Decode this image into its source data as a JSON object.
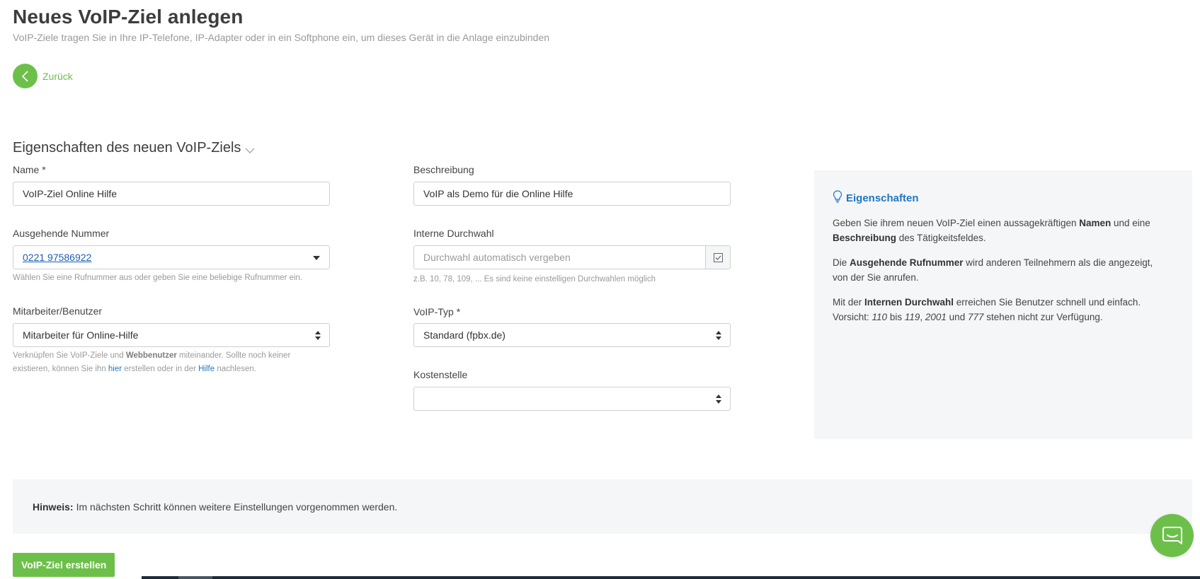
{
  "header": {
    "title": "Neues VoIP-Ziel anlegen",
    "subtitle": "VoIP-Ziele tragen Sie in Ihre IP-Telefone, IP-Adapter oder in ein Softphone ein, um dieses Gerät in die Anlage einzubinden"
  },
  "back": {
    "label": "Zurück",
    "icon": "chevron-left-icon"
  },
  "section": {
    "title": "Eigenschaften des neuen VoIP-Ziels"
  },
  "form": {
    "name": {
      "label": "Name *",
      "value": "VoIP-Ziel Online Hilfe"
    },
    "beschreibung": {
      "label": "Beschreibung",
      "value": "VoIP als Demo für die Online Hilfe"
    },
    "ausgehende_nummer": {
      "label": "Ausgehende Nummer",
      "value": "0221 97586922",
      "help": "Wählen Sie eine Rufnummer aus oder geben Sie eine beliebige Rufnummer ein."
    },
    "interne_durchwahl": {
      "label": "Interne Durchwahl",
      "placeholder": "Durchwahl automatisch vergeben",
      "help": "z.B. 10, 78, 109, ... Es sind keine einstelligen Durchwahlen möglich"
    },
    "mitarbeiter": {
      "label": "Mitarbeiter/Benutzer",
      "value": "Mitarbeiter für Online-Hilfe",
      "help_part1": "Verknüpfen Sie VoIP-Ziele und ",
      "help_bold": "Webbenutzer",
      "help_part2": " miteinander. Sollte noch keiner",
      "help_line2_a": "existieren, können Sie ihn ",
      "help_link1": "hier",
      "help_line2_b": " erstellen oder in der ",
      "help_link2": "Hilfe",
      "help_line2_c": " nachlesen."
    },
    "voip_typ": {
      "label": "VoIP-Typ *",
      "value": "Standard (fpbx.de)"
    },
    "kostenstelle": {
      "label": "Kostenstelle",
      "value": ""
    }
  },
  "info": {
    "title": "Eigenschaften",
    "p1_a": "Geben Sie ihrem neuen VoIP-Ziel einen aussagekräftigen ",
    "p1_b": "Namen",
    "p1_c": " und eine",
    "p1_d": "Beschreibung",
    "p1_e": " des Tätigkeitsfeldes.",
    "p2_a": "Die ",
    "p2_b": "Ausgehende Rufnummer",
    "p2_c": " wird anderen Teilnehmern als die angezeigt,",
    "p2_d": "von der Sie anrufen.",
    "p3_a": "Mit der ",
    "p3_b": "Internen Durchwahl",
    "p3_c": " erreichen Sie Benutzer schnell und einfach.",
    "p3_d": "Vorsicht: ",
    "p3_e": "110",
    "p3_f": " bis ",
    "p3_g": "119",
    "p3_h": ", ",
    "p3_i": "2001",
    "p3_j": " und ",
    "p3_k": "777",
    "p3_l": " stehen nicht zur Verfügung."
  },
  "notice": {
    "label": "Hinweis:",
    "text": "Im nächsten Schritt können weitere Einstellungen vorgenommen werden."
  },
  "submit": {
    "label": "VoIP-Ziel erstellen"
  },
  "colors": {
    "accent": "#6cc04a",
    "link": "#1f78c1",
    "panel": "#f5f6f7"
  }
}
